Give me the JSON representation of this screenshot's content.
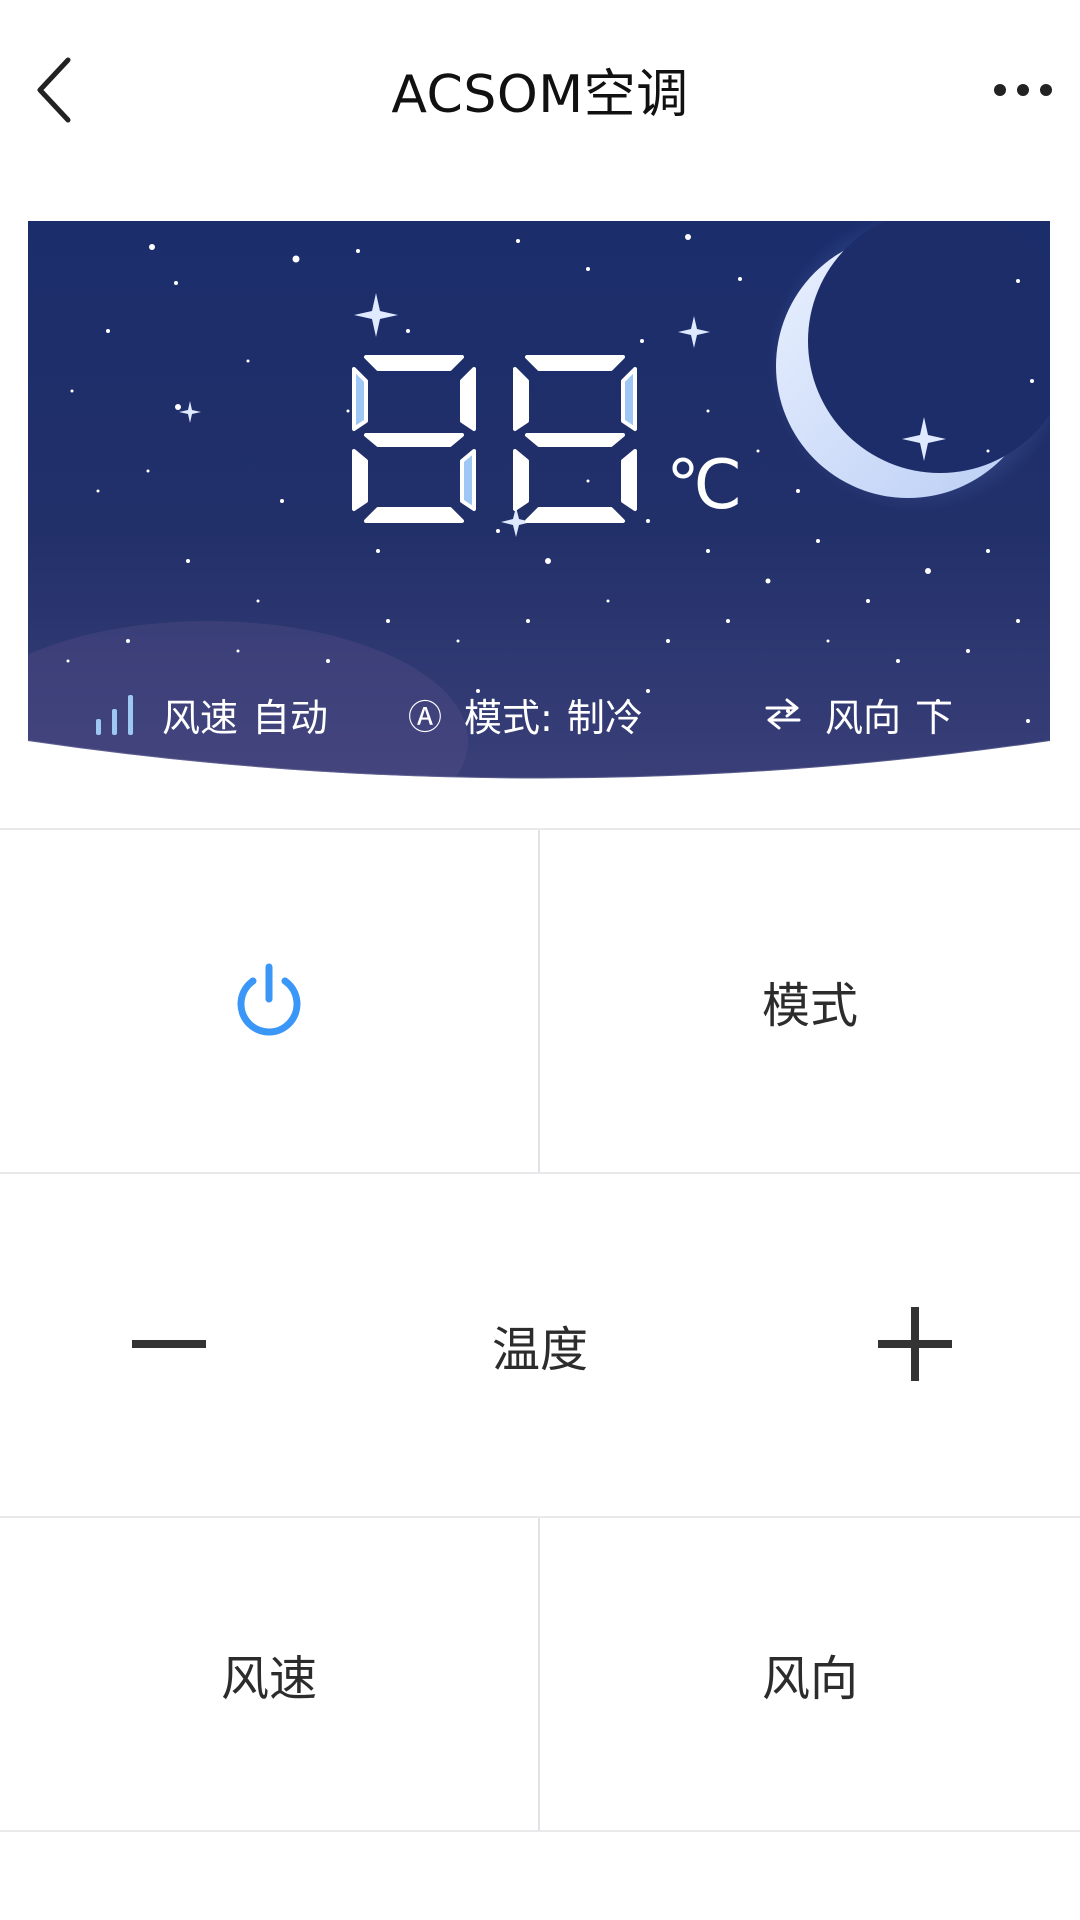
{
  "header": {
    "title": "ACSOM空调",
    "back_icon": "chevron-left-icon",
    "more_icon": "more-horizontal-icon"
  },
  "display": {
    "temperature": "88",
    "unit": "℃",
    "status": {
      "fan_speed_label": "风速",
      "fan_speed_value": "自动",
      "mode_icon_text": "Ⓐ",
      "mode_label": "模式:",
      "mode_value": "制冷",
      "direction_label": "风向",
      "direction_value": "下"
    },
    "background_color": "#1d2d66",
    "accent_color": "#9fc7f5"
  },
  "controls": {
    "power_icon": "power-icon",
    "power_color": "#3a97f7",
    "mode_label": "模式",
    "temp_label": "温度",
    "speed_label": "风速",
    "direction_label": "风向"
  }
}
